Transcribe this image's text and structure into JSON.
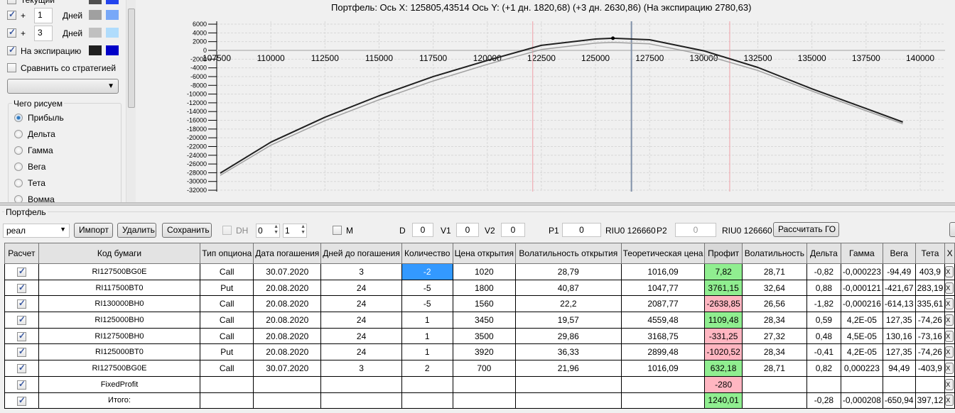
{
  "left": {
    "rows": [
      {
        "label": "Текущий",
        "checked": false,
        "days": null,
        "colors": [
          "#505050",
          "#2244ee"
        ]
      },
      {
        "label": "+",
        "checked": true,
        "days": "1",
        "unit": "Дней",
        "colors": [
          "#a0a0a0",
          "#78a8f8"
        ]
      },
      {
        "label": "+",
        "checked": true,
        "days": "3",
        "unit": "Дней",
        "colors": [
          "#c0c0c0",
          "#b0dcfc"
        ]
      },
      {
        "label": "На экспирацию",
        "checked": true,
        "days": null,
        "colors": [
          "#202020",
          "#0000c8"
        ]
      }
    ],
    "compare_label": "Сравнить со стратегией",
    "strategy_select": "",
    "draw_group": "Чего рисуем",
    "radios": [
      {
        "label": "Прибыль",
        "on": true
      },
      {
        "label": "Дельта",
        "on": false
      },
      {
        "label": "Гамма",
        "on": false
      },
      {
        "label": "Вега",
        "on": false
      },
      {
        "label": "Тета",
        "on": false
      },
      {
        "label": "Вомма",
        "on": false
      }
    ]
  },
  "chart_data": {
    "type": "line",
    "title": "Портфель: Ось X: 125805,43514 Ось Y:  (+1 дн. 1820,68)  (+3 дн. 2630,86)  (На экспирацию 2780,63)",
    "xlim": [
      107500,
      141150
    ],
    "ylim": [
      -32000,
      6000
    ],
    "xticks": [
      107500,
      110000,
      112500,
      115000,
      117500,
      120000,
      122500,
      125000,
      127500,
      130000,
      132500,
      135000,
      137500,
      140000
    ],
    "yticks": [
      6000,
      4000,
      2000,
      0,
      -2000,
      -4000,
      -6000,
      -8000,
      -10000,
      -12000,
      -14000,
      -16000,
      -18000,
      -20000,
      -22000,
      -24000,
      -26000,
      -28000,
      -30000,
      -32000
    ],
    "grid": true,
    "series": [
      {
        "color": "#a0a0a0",
        "x": [
          107660,
          110000,
          112500,
          115000,
          117500,
          120000,
          122500,
          125000,
          125805,
          127500,
          130000,
          132500,
          135000,
          137500,
          139200
        ],
        "y": [
          -28600,
          -21700,
          -16100,
          -11300,
          -7000,
          -3200,
          200,
          1650,
          1820,
          1500,
          -1000,
          -4600,
          -9300,
          -13800,
          -16800
        ]
      },
      {
        "color": "#202020",
        "x": [
          107660,
          110000,
          112500,
          115000,
          117500,
          120000,
          122500,
          125000,
          125805,
          127500,
          130000,
          132500,
          135000,
          137500,
          139200
        ],
        "y": [
          -28100,
          -21000,
          -15300,
          -10400,
          -6000,
          -2300,
          1150,
          2600,
          2780,
          2430,
          -100,
          -3900,
          -8800,
          -13300,
          -16400
        ]
      }
    ],
    "marker": {
      "x": 125805,
      "y": 2780
    },
    "vlines": [
      {
        "x": 122100,
        "color": "#f0a0a8"
      },
      {
        "x": 126660,
        "color": "#8090a8"
      },
      {
        "x": 131200,
        "color": "#f0a0a8"
      }
    ]
  },
  "portfolio": {
    "group": "Портфель",
    "select": "реал",
    "import": "Импорт",
    "delete": "Удалить",
    "save": "Сохранить",
    "dh": "DH",
    "spin1": "0",
    "spin2": "1",
    "m": "M",
    "d_label": "D",
    "d": "0",
    "v1_label": "V1",
    "v1": "0",
    "v2_label": "V2",
    "v2": "0",
    "p1_label": "P1",
    "p1": "0",
    "riu1": "RIU0 126660",
    "p2_label": "P2",
    "p2": "0",
    "riu2": "RIU0 126660",
    "calc": "Рассчитать ГО"
  },
  "table": {
    "headers": [
      "Расчет",
      "Код бумаги",
      "Тип опциона",
      "Дата погашения",
      "Дней до погашения",
      "Количество",
      "Цена открытия",
      "Волатильность открытия",
      "Теоретическая цена",
      "Профит",
      "Волатильность",
      "Дельта",
      "Гамма",
      "Вега",
      "Тета",
      "X"
    ],
    "rows": [
      [
        "RI127500BG0E",
        "Call",
        "30.07.2020",
        "3",
        "-2",
        "1020",
        "28,79",
        "1016,09",
        "7,82",
        "28,71",
        "-0,82",
        "-0,000223",
        "-94,49",
        "403,9"
      ],
      [
        "RI117500BT0",
        "Put",
        "20.08.2020",
        "24",
        "-5",
        "1800",
        "40,87",
        "1047,77",
        "3761,15",
        "32,64",
        "0,88",
        "-0,000121",
        "-421,67",
        "283,19"
      ],
      [
        "RI130000BH0",
        "Call",
        "20.08.2020",
        "24",
        "-5",
        "1560",
        "22,2",
        "2087,77",
        "-2638,85",
        "26,56",
        "-1,82",
        "-0,000216",
        "-614,13",
        "335,61"
      ],
      [
        "RI125000BH0",
        "Call",
        "20.08.2020",
        "24",
        "1",
        "3450",
        "19,57",
        "4559,48",
        "1109,48",
        "28,34",
        "0,59",
        "4,2E-05",
        "127,35",
        "-74,26"
      ],
      [
        "RI127500BH0",
        "Call",
        "20.08.2020",
        "24",
        "1",
        "3500",
        "29,86",
        "3168,75",
        "-331,25",
        "27,32",
        "0,48",
        "4,5E-05",
        "130,16",
        "-73,16"
      ],
      [
        "RI125000BT0",
        "Put",
        "20.08.2020",
        "24",
        "1",
        "3920",
        "36,33",
        "2899,48",
        "-1020,52",
        "28,34",
        "-0,41",
        "4,2E-05",
        "127,35",
        "-74,26"
      ],
      [
        "RI127500BG0E",
        "Call",
        "30.07.2020",
        "3",
        "2",
        "700",
        "21,96",
        "1016,09",
        "632,18",
        "28,71",
        "0,82",
        "0,000223",
        "94,49",
        "-403,9"
      ],
      [
        "FixedProfit",
        "",
        "",
        "",
        "",
        "",
        "",
        "",
        "-280",
        "",
        "",
        "",
        "",
        ""
      ],
      [
        "Итого:",
        "",
        "",
        "",
        "",
        "",
        "",
        "",
        "1240,01",
        "",
        "-0,28",
        "-0,000208",
        "-650,94",
        "397,12"
      ]
    ]
  }
}
